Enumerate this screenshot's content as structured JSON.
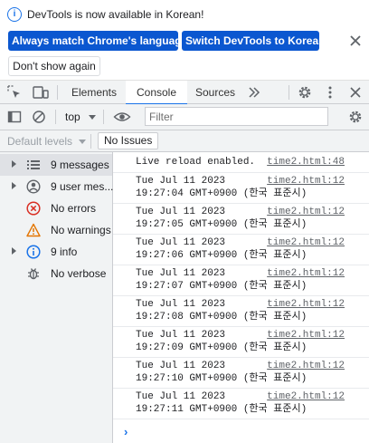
{
  "infobar": {
    "message": "DevTools is now available in Korean!",
    "match_button": "Always match Chrome's language",
    "switch_button": "Switch DevTools to Korean",
    "dismiss_button": "Don't show again"
  },
  "tabs": {
    "elements": "Elements",
    "console": "Console",
    "sources": "Sources",
    "active": "Console"
  },
  "toolbar": {
    "context": "top",
    "filter_placeholder": "Filter"
  },
  "levels": {
    "default_levels": "Default levels",
    "issues": "No Issues"
  },
  "sidebar": {
    "items": [
      {
        "label": "9 messages",
        "icon": "list-icon",
        "expandable": true,
        "selected": true
      },
      {
        "label": "9 user mes...",
        "icon": "user-icon",
        "expandable": true
      },
      {
        "label": "No errors",
        "icon": "error-icon",
        "expandable": false
      },
      {
        "label": "No warnings",
        "icon": "warning-icon",
        "expandable": false
      },
      {
        "label": "9 info",
        "icon": "info-icon",
        "expandable": true
      },
      {
        "label": "No verbose",
        "icon": "bug-icon",
        "expandable": false
      }
    ]
  },
  "console": {
    "messages": [
      {
        "lines": [
          "Live reload enabled."
        ],
        "source": "time2.html:48"
      },
      {
        "lines": [
          "Tue Jul 11 2023",
          "19:27:04 GMT+0900 (한국 표준시)"
        ],
        "source": "time2.html:12"
      },
      {
        "lines": [
          "Tue Jul 11 2023",
          "19:27:05 GMT+0900 (한국 표준시)"
        ],
        "source": "time2.html:12"
      },
      {
        "lines": [
          "Tue Jul 11 2023",
          "19:27:06 GMT+0900 (한국 표준시)"
        ],
        "source": "time2.html:12"
      },
      {
        "lines": [
          "Tue Jul 11 2023",
          "19:27:07 GMT+0900 (한국 표준시)"
        ],
        "source": "time2.html:12"
      },
      {
        "lines": [
          "Tue Jul 11 2023",
          "19:27:08 GMT+0900 (한국 표준시)"
        ],
        "source": "time2.html:12"
      },
      {
        "lines": [
          "Tue Jul 11 2023",
          "19:27:09 GMT+0900 (한국 표준시)"
        ],
        "source": "time2.html:12"
      },
      {
        "lines": [
          "Tue Jul 11 2023",
          "19:27:10 GMT+0900 (한국 표준시)"
        ],
        "source": "time2.html:12"
      },
      {
        "lines": [
          "Tue Jul 11 2023",
          "19:27:11 GMT+0900 (한국 표준시)"
        ],
        "source": "time2.html:12"
      }
    ],
    "prompt": "›"
  },
  "colors": {
    "accent": "#1a73e8",
    "primary_button": "#0b57d0",
    "error": "#d93025",
    "warning": "#e37400"
  }
}
